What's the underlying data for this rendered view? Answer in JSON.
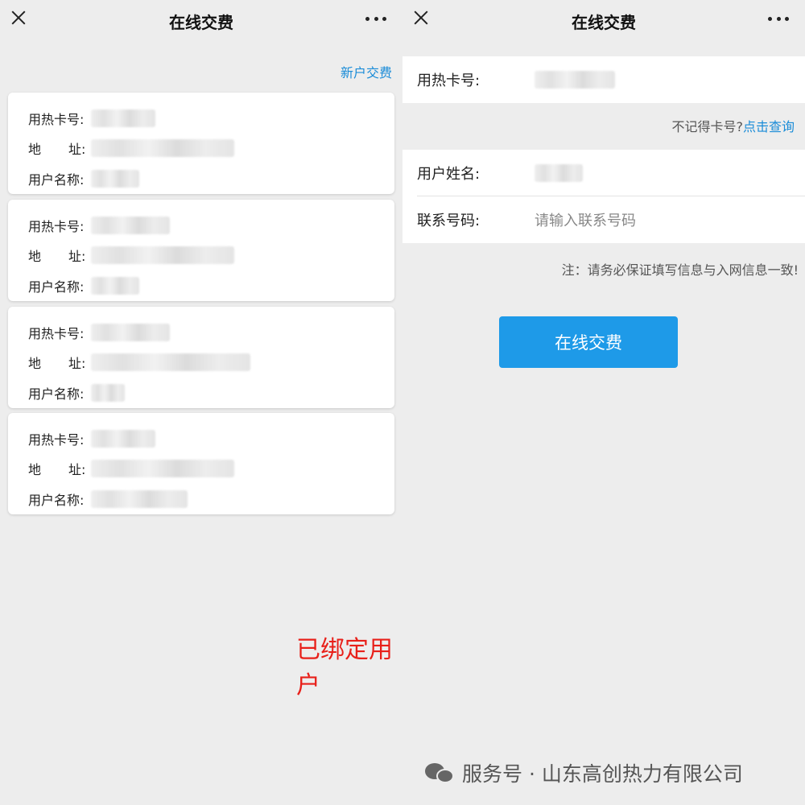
{
  "left": {
    "nav": {
      "title": "在线交费"
    },
    "new_user_link": "新户交费",
    "labels": {
      "card_no": "用热卡号:",
      "addr_a": "地",
      "addr_b": "址:",
      "name": "用户名称:"
    },
    "cards_count_visible": 4,
    "caption": "已绑定用户"
  },
  "right": {
    "nav": {
      "title": "在线交费"
    },
    "card_no_label": "用热卡号:",
    "forgot_text": "不记得卡号?",
    "forgot_link": "点击查询",
    "user_name_label": "用户姓名:",
    "phone_label": "联系号码:",
    "phone_placeholder": "请输入联系号码",
    "note": "注：请务必保证填写信息与入网信息一致!",
    "pay_button": "在线交费"
  },
  "watermark": {
    "text": "服务号 · 山东高创热力有限公司",
    "icon": "wechat-icon"
  },
  "colors": {
    "link": "#1a8cd8",
    "button": "#1e9ae8",
    "caption": "#e8201a",
    "background": "#ededed"
  }
}
